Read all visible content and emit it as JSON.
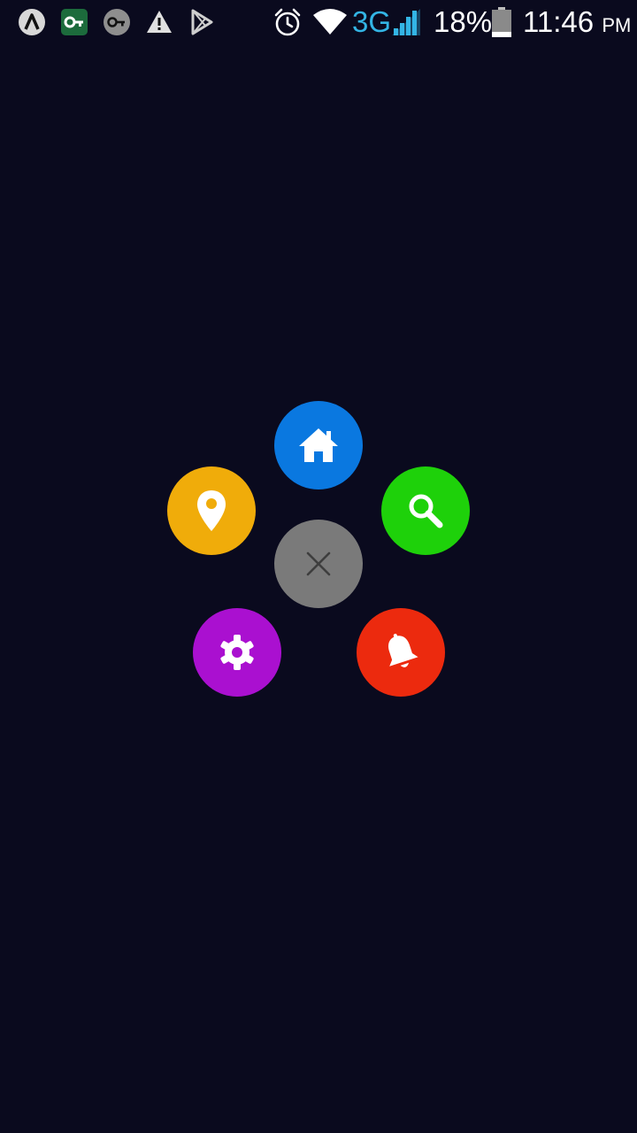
{
  "status_bar": {
    "left_icons": [
      "app-launcher-icon",
      "vpn-key-icon",
      "key-icon",
      "warning-icon",
      "play-store-icon"
    ],
    "right_icons": [
      "alarm-icon",
      "wifi-icon",
      "signal-icon",
      "battery-icon"
    ],
    "network": "3G",
    "battery_percent": "18%",
    "battery_level": 0.18,
    "time": "11:46",
    "time_suffix": "PM"
  },
  "menu": {
    "items": [
      {
        "name": "home",
        "icon": "home-icon",
        "color": "#0a78e0"
      },
      {
        "name": "location",
        "icon": "location-pin-icon",
        "color": "#f0ac0a"
      },
      {
        "name": "search",
        "icon": "search-icon",
        "color": "#1ed10a"
      },
      {
        "name": "settings",
        "icon": "gear-icon",
        "color": "#aa10d0"
      },
      {
        "name": "notifications",
        "icon": "bell-icon",
        "color": "#ec2a0e"
      }
    ],
    "close": {
      "icon": "close-icon",
      "color": "#7a7a7a"
    }
  },
  "colors": {
    "background": "#0a0a1e",
    "status_accent": "#33b5e5"
  }
}
